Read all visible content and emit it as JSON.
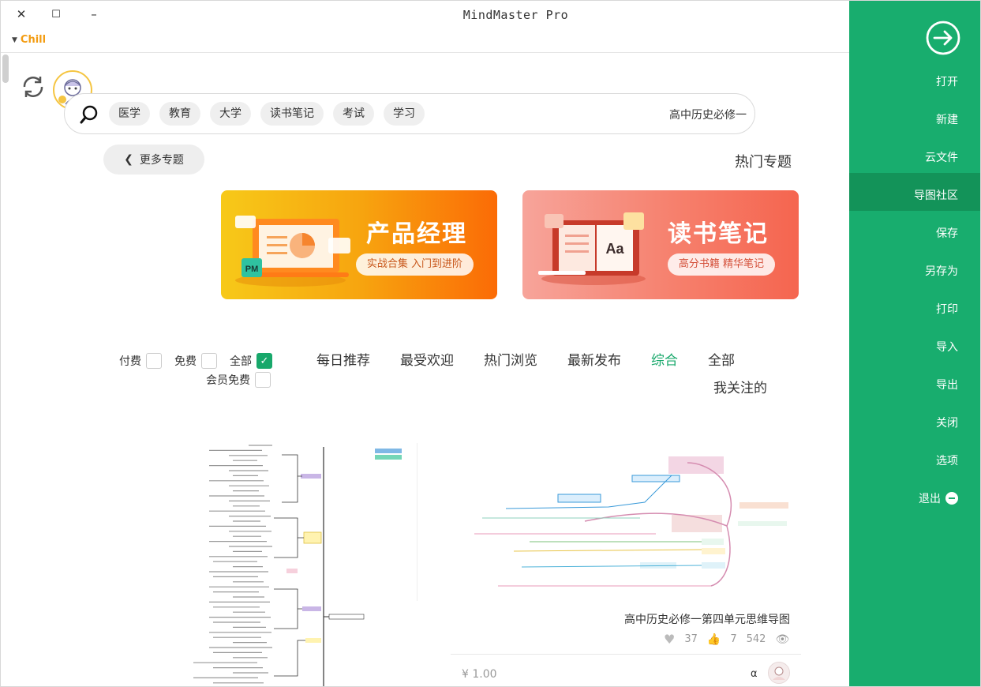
{
  "window": {
    "title": "MindMaster Pro",
    "theme_label": "Chill",
    "minimize_glyph": "–",
    "maximize_glyph": "☐",
    "close_glyph": "✕"
  },
  "search": {
    "value": "高中历史必修一",
    "chips": [
      "学习",
      "考试",
      "读书笔记",
      "大学",
      "教育",
      "医学"
    ]
  },
  "hot": {
    "title": "热门专题",
    "more_label": "更多专题",
    "banners": [
      {
        "title": "读书笔记",
        "pill": "高分书籍 精华笔记"
      },
      {
        "title": "产品经理",
        "pill": "实战合集 入门到进阶"
      }
    ]
  },
  "tabs": {
    "items": [
      "全部",
      "综合",
      "最新发布",
      "热门浏览",
      "最受欢迎",
      "每日推荐"
    ],
    "active_index": 1,
    "extra": "我关注的"
  },
  "filters": {
    "all": "全部",
    "free": "免费",
    "paid": "付费",
    "member_free": "会员免费",
    "all_checked": true
  },
  "cards": [
    {
      "title": "高中历史必修一第四单元思维导图",
      "views": "542",
      "likes": "7",
      "favorites": "37",
      "author": "α",
      "price": "¥ 1.00"
    }
  ],
  "sidebar": {
    "items": [
      "打开",
      "新建",
      "云文件",
      "导图社区",
      "保存",
      "另存为",
      "打印",
      "导入",
      "导出",
      "关闭",
      "选项",
      "退出"
    ],
    "active_index": 3
  },
  "colors": {
    "accent": "#18ad6e",
    "accent_dark": "#139359",
    "theme": "#f39c12"
  }
}
